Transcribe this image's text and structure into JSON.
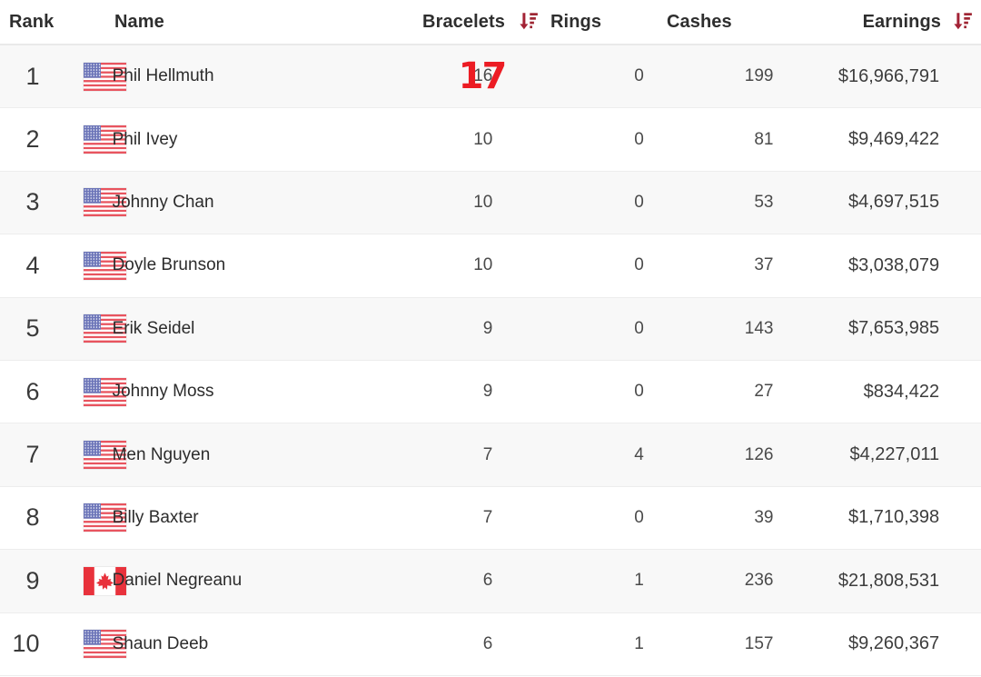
{
  "table": {
    "columns": [
      {
        "key": "rank",
        "label": "Rank",
        "sort_icon": null
      },
      {
        "key": "name",
        "label": "Name",
        "sort_icon": null
      },
      {
        "key": "bracelets",
        "label": "Bracelets",
        "sort_icon": "sort-descending-icon"
      },
      {
        "key": "rings",
        "label": "Rings",
        "sort_icon": null
      },
      {
        "key": "cashes",
        "label": "Cashes",
        "sort_icon": null
      },
      {
        "key": "earnings",
        "label": "Earnings",
        "sort_icon": "sort-descending-icon"
      }
    ],
    "header": {
      "rank": "Rank",
      "name": "Name",
      "bracelets": "Bracelets",
      "rings": "Rings",
      "cashes": "Cashes",
      "earnings": "Earnings"
    },
    "rows": [
      {
        "rank": "1",
        "flag": "flag-united-states",
        "name": "Phil Hellmuth",
        "bracelets": "16",
        "rings": "0",
        "cashes": "199",
        "earnings": "$16,966,791"
      },
      {
        "rank": "2",
        "flag": "flag-united-states",
        "name": "Phil Ivey",
        "bracelets": "10",
        "rings": "0",
        "cashes": "81",
        "earnings": "$9,469,422"
      },
      {
        "rank": "3",
        "flag": "flag-united-states",
        "name": "Johnny Chan",
        "bracelets": "10",
        "rings": "0",
        "cashes": "53",
        "earnings": "$4,697,515"
      },
      {
        "rank": "4",
        "flag": "flag-united-states",
        "name": "Doyle Brunson",
        "bracelets": "10",
        "rings": "0",
        "cashes": "37",
        "earnings": "$3,038,079"
      },
      {
        "rank": "5",
        "flag": "flag-united-states",
        "name": "Erik Seidel",
        "bracelets": "9",
        "rings": "0",
        "cashes": "143",
        "earnings": "$7,653,985"
      },
      {
        "rank": "6",
        "flag": "flag-united-states",
        "name": "Johnny Moss",
        "bracelets": "9",
        "rings": "0",
        "cashes": "27",
        "earnings": "$834,422"
      },
      {
        "rank": "7",
        "flag": "flag-united-states",
        "name": "Men Nguyen",
        "bracelets": "7",
        "rings": "4",
        "cashes": "126",
        "earnings": "$4,227,011"
      },
      {
        "rank": "8",
        "flag": "flag-united-states",
        "name": "Billy Baxter",
        "bracelets": "7",
        "rings": "0",
        "cashes": "39",
        "earnings": "$1,710,398"
      },
      {
        "rank": "9",
        "flag": "flag-canada",
        "name": "Daniel Negreanu",
        "bracelets": "6",
        "rings": "1",
        "cashes": "236",
        "earnings": "$21,808,531"
      },
      {
        "rank": "10",
        "flag": "flag-united-states",
        "name": "Shaun Deeb",
        "bracelets": "6",
        "rings": "1",
        "cashes": "157",
        "earnings": "$9,260,367"
      }
    ]
  },
  "annotation": {
    "row_index": 0,
    "column": "bracelets",
    "text": "17",
    "color": "#ec1c24"
  },
  "colors": {
    "sort_icon": "#9e2633",
    "sort_icon_arrow": "#a32235",
    "row_alt_bg": "#f8f8f8",
    "row_bg": "#ffffff",
    "row_border": "#ededed",
    "header_text": "#2e2e2e",
    "body_text": "#3d3d3d"
  }
}
